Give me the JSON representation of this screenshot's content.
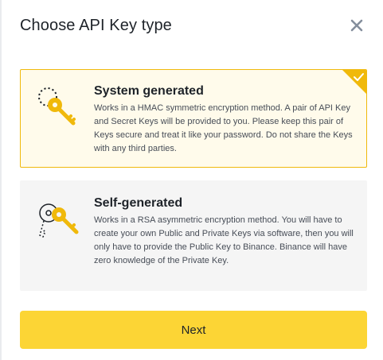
{
  "dialog": {
    "title": "Choose API Key type",
    "close_icon": "close-icon"
  },
  "options": [
    {
      "title": "System generated",
      "description": "Works in a HMAC symmetric encryption method. A pair of API Key and Secret Keys will be provided to you. Please keep this pair of Keys secure and treat it like your password. Do not share the Keys with any third parties.",
      "selected": true,
      "icon": "key-icon"
    },
    {
      "title": "Self-generated",
      "description": "Works in a RSA asymmetric encryption method. You will have to create your own Public and Private Keys via software, then you will only have to provide the Public Key to Binance. Binance will have zero knowledge of the Private Key.",
      "selected": false,
      "icon": "key-pair-icon"
    }
  ],
  "next_button": {
    "label": "Next"
  },
  "colors": {
    "accent": "#fcd535",
    "selected_border": "#f0b90b",
    "selected_background": "#fffbeb",
    "card_background": "#f5f5f5"
  }
}
